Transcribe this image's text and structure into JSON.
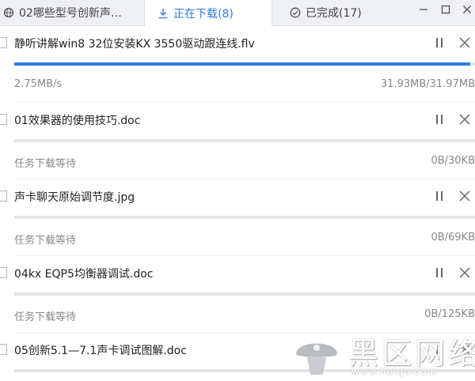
{
  "tabs": [
    {
      "label": "02哪些型号创新声…",
      "icon": "globe-icon"
    },
    {
      "label": "正在下载(8)",
      "icon": "download-icon"
    },
    {
      "label": "已完成(17)",
      "icon": "check-circle-icon"
    }
  ],
  "window_controls": {
    "minimize": "—",
    "maximize": "☐",
    "close": "✕"
  },
  "downloads": [
    {
      "name": "静听讲解win8 32位安装KX 3550驱动跟连线.flv",
      "status": "2.75MB/s",
      "size": "31.93MB/31.97MB",
      "progress": 0.99
    },
    {
      "name": "01效果器的使用技巧.doc",
      "status": "任务下载等待",
      "size": "0B/30KB",
      "progress": 0
    },
    {
      "name": "声卡聊天原始调节度.jpg",
      "status": "任务下载等待",
      "size": "0B/69KB",
      "progress": 0
    },
    {
      "name": "04kx EQP5均衡器调试.doc",
      "status": "任务下载等待",
      "size": "0B/125KB",
      "progress": 0
    },
    {
      "name": "05创新5.1—7.1声卡调试图解.doc",
      "status": "",
      "size": "",
      "progress": 0
    }
  ],
  "watermark": {
    "text": "黑区网络",
    "url": "www.heiqu.com"
  },
  "colors": {
    "accent": "#2d7be0",
    "tabbar": "#eef0f3",
    "muted_text": "#888888"
  }
}
